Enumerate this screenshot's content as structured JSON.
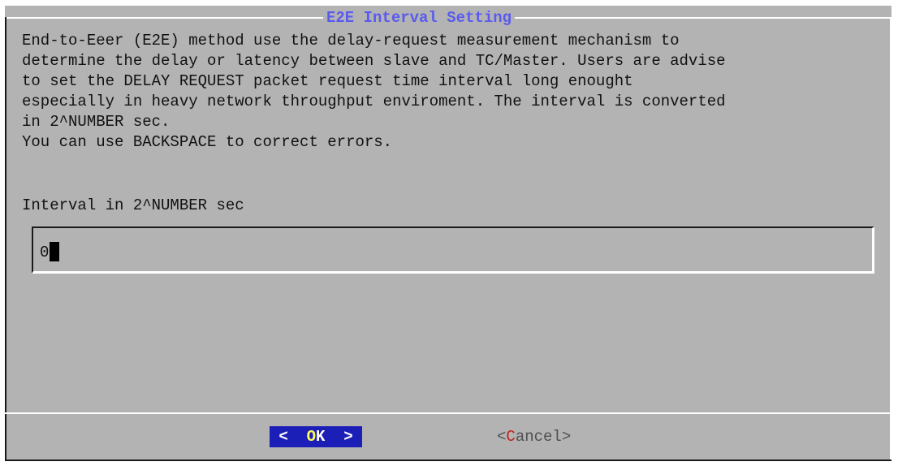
{
  "dialog": {
    "title": "E2E Interval Setting",
    "description_lines": [
      "End-to-Eeer (E2E) method use the delay-request measurement mechanism to",
      "determine the delay or latency between slave and TC/Master. Users are advise",
      "to set the DELAY REQUEST packet request time interval long enought",
      "especially in heavy network throughput enviroment. The interval is converted",
      "in 2^NUMBER sec.",
      "You can use BACKSPACE to correct errors."
    ],
    "prompt": "Interval in 2^NUMBER sec",
    "input_value": "0"
  },
  "buttons": {
    "ok": {
      "left": "<",
      "hotkey": "O",
      "rest": "K",
      "right": ">"
    },
    "cancel": {
      "left": "<",
      "hotkey": "C",
      "rest": "ancel",
      "right": ">"
    }
  },
  "colors": {
    "background": "#b3b3b3",
    "title": "#5a5af0",
    "ok_bg": "#1b1fb7",
    "ok_hotkey": "#ffff55",
    "cancel_hotkey": "#c0241c"
  }
}
